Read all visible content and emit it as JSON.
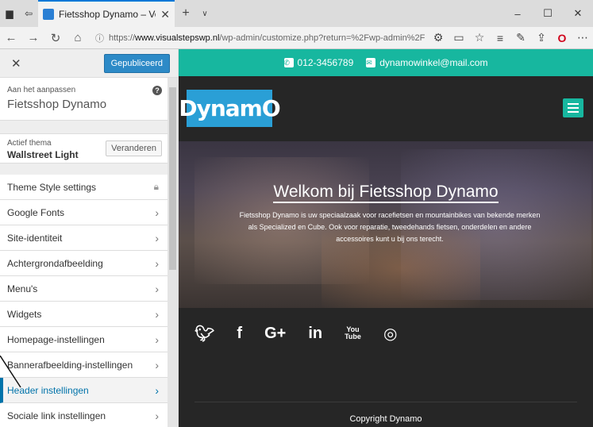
{
  "browser": {
    "tab_title": "Fietsshop Dynamo – Vo",
    "url_prefix": "https://",
    "url_domain": "www.visualstepswp.nl",
    "url_rest": "/wp-admin/customize.php?return=%2Fwp-admin%2F"
  },
  "customizer": {
    "publish_label": "Gepubliceerd",
    "customizing_label": "Aan het aanpassen",
    "site_name": "Fietsshop Dynamo",
    "active_theme_label": "Actief thema",
    "active_theme_name": "Wallstreet Light",
    "change_button": "Veranderen",
    "menu_items": [
      {
        "label": "Theme Style settings"
      },
      {
        "label": "Google Fonts"
      },
      {
        "label": "Site-identiteit"
      },
      {
        "label": "Achtergrondafbeelding"
      },
      {
        "label": "Menu's"
      },
      {
        "label": "Widgets"
      },
      {
        "label": "Homepage-instellingen"
      },
      {
        "label": "Bannerafbeelding-instellingen"
      },
      {
        "label": "Header instellingen"
      },
      {
        "label": "Sociale link instellingen"
      }
    ]
  },
  "preview": {
    "phone": "012-3456789",
    "email": "dynamowinkel@mail.com",
    "logo_text": "DynamO",
    "hero_title": "Welkom bij Fietsshop Dynamo",
    "hero_text": "Fietsshop Dynamo is uw speciaalzaak voor racefietsen en mountainbikes van bekende merken als Specialized en Cube. Ook voor reparatie, tweedehands fietsen, onderdelen en andere accessoires kunt u bij ons terecht.",
    "social_icons": [
      "twitter-icon",
      "facebook-icon",
      "google-plus-icon",
      "linkedin-icon",
      "youtube-icon",
      "instagram-icon"
    ],
    "copyright": "Copyright Dynamo"
  },
  "colors": {
    "accent": "#17b79f",
    "logo_bg": "#2a9fd6",
    "publish": "#2d8ac7",
    "active_link": "#0073aa"
  }
}
